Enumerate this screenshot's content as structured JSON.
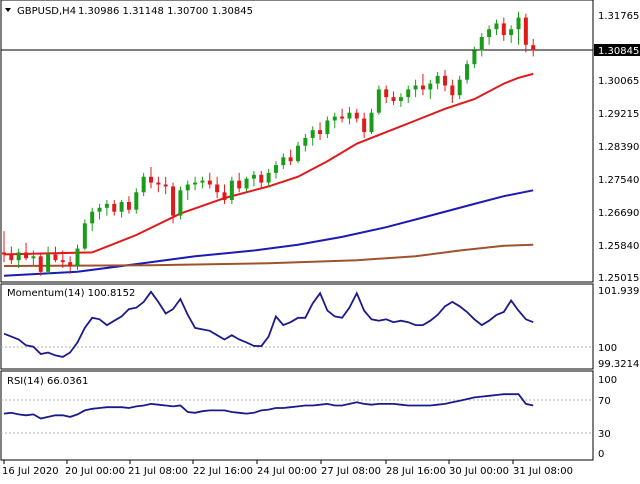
{
  "header": {
    "symbol": "GBPUSD,H4",
    "ohlc": "1.30986 1.31148 1.30700 1.30845"
  },
  "price_panel": {
    "current_price": "1.30845",
    "y_ticks": [
      "1.31765",
      "1.30065",
      "1.29215",
      "1.28390",
      "1.27540",
      "1.26690",
      "1.25840",
      "1.25015"
    ]
  },
  "momentum_panel": {
    "label": "Momentum(14) 100.8152",
    "y_ticks": [
      "101.9397",
      "100",
      "99.3214"
    ]
  },
  "rsi_panel": {
    "label": "RSI(14) 66.0361",
    "y_ticks": [
      "100",
      "70",
      "30",
      "0"
    ]
  },
  "x_ticks": [
    "16 Jul 2020",
    "20 Jul 00:00",
    "21 Jul 08:00",
    "22 Jul 16:00",
    "24 Jul 00:00",
    "27 Jul 08:00",
    "28 Jul 16:00",
    "30 Jul 00:00",
    "31 Jul 08:00"
  ],
  "colors": {
    "bull": "#1a9c1a",
    "bear": "#e01a1a",
    "sma_fast": "#e01a1a",
    "sma_mid": "#1a1ab4",
    "sma_slow": "#a0522d",
    "oscillator": "#1a1a8c"
  },
  "chart_data": [
    {
      "type": "candlestick",
      "title": "GBPUSD,H4",
      "ylim": [
        1.2494,
        1.3205
      ],
      "candles": [
        {
          "o": 1.2565,
          "h": 1.262,
          "l": 1.254,
          "c": 1.256
        },
        {
          "o": 1.256,
          "h": 1.258,
          "l": 1.2535,
          "c": 1.2545
        },
        {
          "o": 1.2545,
          "h": 1.2575,
          "l": 1.2525,
          "c": 1.2565
        },
        {
          "o": 1.2565,
          "h": 1.259,
          "l": 1.2545,
          "c": 1.255
        },
        {
          "o": 1.255,
          "h": 1.257,
          "l": 1.253,
          "c": 1.2555
        },
        {
          "o": 1.2555,
          "h": 1.2565,
          "l": 1.2505,
          "c": 1.2515
        },
        {
          "o": 1.2515,
          "h": 1.258,
          "l": 1.251,
          "c": 1.256
        },
        {
          "o": 1.256,
          "h": 1.258,
          "l": 1.254,
          "c": 1.2545
        },
        {
          "o": 1.2545,
          "h": 1.257,
          "l": 1.2525,
          "c": 1.254
        },
        {
          "o": 1.254,
          "h": 1.2555,
          "l": 1.251,
          "c": 1.253
        },
        {
          "o": 1.253,
          "h": 1.2585,
          "l": 1.252,
          "c": 1.2575
        },
        {
          "o": 1.2575,
          "h": 1.265,
          "l": 1.257,
          "c": 1.264
        },
        {
          "o": 1.264,
          "h": 1.268,
          "l": 1.262,
          "c": 1.267
        },
        {
          "o": 1.267,
          "h": 1.269,
          "l": 1.265,
          "c": 1.268
        },
        {
          "o": 1.268,
          "h": 1.27,
          "l": 1.266,
          "c": 1.269
        },
        {
          "o": 1.269,
          "h": 1.27,
          "l": 1.266,
          "c": 1.267
        },
        {
          "o": 1.267,
          "h": 1.27,
          "l": 1.2655,
          "c": 1.2695
        },
        {
          "o": 1.2695,
          "h": 1.271,
          "l": 1.2665,
          "c": 1.2675
        },
        {
          "o": 1.2675,
          "h": 1.273,
          "l": 1.2665,
          "c": 1.272
        },
        {
          "o": 1.272,
          "h": 1.277,
          "l": 1.271,
          "c": 1.276
        },
        {
          "o": 1.276,
          "h": 1.2785,
          "l": 1.273,
          "c": 1.2745
        },
        {
          "o": 1.2745,
          "h": 1.276,
          "l": 1.272,
          "c": 1.274
        },
        {
          "o": 1.274,
          "h": 1.276,
          "l": 1.2715,
          "c": 1.2735
        },
        {
          "o": 1.2735,
          "h": 1.2745,
          "l": 1.264,
          "c": 1.266
        },
        {
          "o": 1.266,
          "h": 1.2735,
          "l": 1.265,
          "c": 1.2725
        },
        {
          "o": 1.2725,
          "h": 1.275,
          "l": 1.27,
          "c": 1.274
        },
        {
          "o": 1.274,
          "h": 1.276,
          "l": 1.2725,
          "c": 1.2745
        },
        {
          "o": 1.2745,
          "h": 1.276,
          "l": 1.273,
          "c": 1.275
        },
        {
          "o": 1.275,
          "h": 1.277,
          "l": 1.273,
          "c": 1.274
        },
        {
          "o": 1.274,
          "h": 1.276,
          "l": 1.2705,
          "c": 1.272
        },
        {
          "o": 1.272,
          "h": 1.274,
          "l": 1.269,
          "c": 1.27
        },
        {
          "o": 1.27,
          "h": 1.276,
          "l": 1.269,
          "c": 1.275
        },
        {
          "o": 1.275,
          "h": 1.277,
          "l": 1.272,
          "c": 1.273
        },
        {
          "o": 1.273,
          "h": 1.276,
          "l": 1.272,
          "c": 1.2755
        },
        {
          "o": 1.2755,
          "h": 1.2775,
          "l": 1.2735,
          "c": 1.2765
        },
        {
          "o": 1.2765,
          "h": 1.2775,
          "l": 1.273,
          "c": 1.2745
        },
        {
          "o": 1.2745,
          "h": 1.278,
          "l": 1.2735,
          "c": 1.277
        },
        {
          "o": 1.277,
          "h": 1.28,
          "l": 1.2755,
          "c": 1.279
        },
        {
          "o": 1.279,
          "h": 1.282,
          "l": 1.278,
          "c": 1.281
        },
        {
          "o": 1.281,
          "h": 1.283,
          "l": 1.279,
          "c": 1.28
        },
        {
          "o": 1.28,
          "h": 1.285,
          "l": 1.2795,
          "c": 1.284
        },
        {
          "o": 1.284,
          "h": 1.287,
          "l": 1.2825,
          "c": 1.286
        },
        {
          "o": 1.286,
          "h": 1.289,
          "l": 1.284,
          "c": 1.288
        },
        {
          "o": 1.288,
          "h": 1.29,
          "l": 1.2855,
          "c": 1.287
        },
        {
          "o": 1.287,
          "h": 1.2915,
          "l": 1.286,
          "c": 1.2905
        },
        {
          "o": 1.2905,
          "h": 1.2925,
          "l": 1.2885,
          "c": 1.2915
        },
        {
          "o": 1.2915,
          "h": 1.2935,
          "l": 1.29,
          "c": 1.291
        },
        {
          "o": 1.291,
          "h": 1.294,
          "l": 1.2895,
          "c": 1.2925
        },
        {
          "o": 1.2925,
          "h": 1.2935,
          "l": 1.29,
          "c": 1.291
        },
        {
          "o": 1.291,
          "h": 1.2925,
          "l": 1.286,
          "c": 1.2875
        },
        {
          "o": 1.2875,
          "h": 1.2935,
          "l": 1.287,
          "c": 1.2925
        },
        {
          "o": 1.2925,
          "h": 1.2995,
          "l": 1.292,
          "c": 1.2985
        },
        {
          "o": 1.2985,
          "h": 1.2995,
          "l": 1.295,
          "c": 1.2965
        },
        {
          "o": 1.2965,
          "h": 1.298,
          "l": 1.2945,
          "c": 1.2955
        },
        {
          "o": 1.2955,
          "h": 1.2975,
          "l": 1.294,
          "c": 1.2965
        },
        {
          "o": 1.2965,
          "h": 1.2995,
          "l": 1.295,
          "c": 1.2985
        },
        {
          "o": 1.2985,
          "h": 1.301,
          "l": 1.2965,
          "c": 1.2995
        },
        {
          "o": 1.2995,
          "h": 1.3025,
          "l": 1.297,
          "c": 1.2985
        },
        {
          "o": 1.2985,
          "h": 1.301,
          "l": 1.296,
          "c": 1.3
        },
        {
          "o": 1.3,
          "h": 1.303,
          "l": 1.2985,
          "c": 1.302
        },
        {
          "o": 1.302,
          "h": 1.3035,
          "l": 1.298,
          "c": 1.2995
        },
        {
          "o": 1.2995,
          "h": 1.301,
          "l": 1.295,
          "c": 1.297
        },
        {
          "o": 1.297,
          "h": 1.302,
          "l": 1.296,
          "c": 1.301
        },
        {
          "o": 1.301,
          "h": 1.306,
          "l": 1.3,
          "c": 1.305
        },
        {
          "o": 1.305,
          "h": 1.3095,
          "l": 1.304,
          "c": 1.3085
        },
        {
          "o": 1.3085,
          "h": 1.313,
          "l": 1.307,
          "c": 1.312
        },
        {
          "o": 1.312,
          "h": 1.315,
          "l": 1.31,
          "c": 1.314
        },
        {
          "o": 1.314,
          "h": 1.3165,
          "l": 1.3125,
          "c": 1.3155
        },
        {
          "o": 1.3155,
          "h": 1.317,
          "l": 1.311,
          "c": 1.3125
        },
        {
          "o": 1.3125,
          "h": 1.315,
          "l": 1.3105,
          "c": 1.314
        },
        {
          "o": 1.314,
          "h": 1.3185,
          "l": 1.31,
          "c": 1.317
        },
        {
          "o": 1.317,
          "h": 1.318,
          "l": 1.308,
          "c": 1.31
        },
        {
          "o": 1.3099,
          "h": 1.3115,
          "l": 1.307,
          "c": 1.3085
        }
      ],
      "series": [
        {
          "type": "line",
          "color": "#e01a1a",
          "points": [
            [
              0,
              1.256
            ],
            [
              12,
              1.2565
            ],
            [
              18,
              1.261
            ],
            [
              24,
              1.2665
            ],
            [
              30,
              1.2705
            ],
            [
              36,
              1.2735
            ],
            [
              40,
              1.276
            ],
            [
              44,
              1.28
            ],
            [
              48,
              1.2845
            ],
            [
              52,
              1.2875
            ],
            [
              56,
              1.2905
            ],
            [
              60,
              1.2935
            ],
            [
              64,
              1.296
            ],
            [
              68,
              1.3
            ],
            [
              70,
              1.3015
            ],
            [
              72,
              1.3025
            ]
          ]
        },
        {
          "type": "line",
          "color": "#1a1ab4",
          "points": [
            [
              0,
              1.2505
            ],
            [
              10,
              1.2515
            ],
            [
              18,
              1.2535
            ],
            [
              26,
              1.2555
            ],
            [
              34,
              1.257
            ],
            [
              40,
              1.2585
            ],
            [
              46,
              1.2605
            ],
            [
              52,
              1.263
            ],
            [
              58,
              1.266
            ],
            [
              64,
              1.269
            ],
            [
              68,
              1.271
            ],
            [
              72,
              1.2725
            ]
          ]
        },
        {
          "type": "line",
          "color": "#a0522d",
          "points": [
            [
              0,
              1.253
            ],
            [
              20,
              1.2532
            ],
            [
              36,
              1.2537
            ],
            [
              48,
              1.2545
            ],
            [
              56,
              1.2555
            ],
            [
              62,
              1.257
            ],
            [
              68,
              1.2582
            ],
            [
              72,
              1.2585
            ]
          ]
        }
      ]
    },
    {
      "type": "line",
      "title": "Momentum(14) 100.8152",
      "ylim": [
        99.25,
        102.05
      ],
      "values": [
        100.4,
        100.3,
        100.2,
        100.0,
        99.95,
        99.7,
        99.75,
        99.65,
        99.6,
        99.75,
        100.1,
        100.6,
        100.95,
        100.9,
        100.7,
        100.85,
        101.0,
        101.25,
        101.3,
        101.5,
        101.85,
        101.5,
        101.1,
        101.25,
        101.6,
        101.05,
        100.6,
        100.55,
        100.5,
        100.35,
        100.2,
        100.35,
        100.2,
        100.1,
        99.98,
        99.97,
        100.3,
        101.0,
        100.7,
        100.8,
        100.95,
        100.95,
        101.45,
        101.8,
        101.2,
        101.0,
        100.95,
        101.3,
        101.8,
        101.2,
        100.9,
        100.85,
        100.9,
        100.8,
        100.85,
        100.8,
        100.7,
        100.7,
        100.85,
        101.05,
        101.35,
        101.5,
        101.35,
        101.15,
        100.9,
        100.7,
        100.85,
        101.05,
        101.15,
        101.55,
        101.2,
        100.9,
        100.8
      ]
    },
    {
      "type": "line",
      "title": "RSI(14) 66.0361",
      "ylim": [
        0,
        100
      ],
      "values": [
        56,
        57,
        55,
        54,
        55,
        50,
        52,
        54,
        54,
        52,
        55,
        60,
        62,
        63,
        64,
        64,
        64,
        63,
        65,
        66,
        68,
        67,
        66,
        65,
        66,
        58,
        57,
        59,
        60,
        60,
        60,
        58,
        57,
        56,
        57,
        60,
        61,
        63,
        63,
        64,
        65,
        66,
        66,
        67,
        68,
        66,
        66,
        68,
        70,
        68,
        67,
        68,
        68,
        68,
        67,
        66,
        66,
        66,
        66,
        67,
        68,
        70,
        72,
        74,
        76,
        77,
        78,
        79,
        80,
        80,
        80,
        68,
        66
      ]
    }
  ]
}
